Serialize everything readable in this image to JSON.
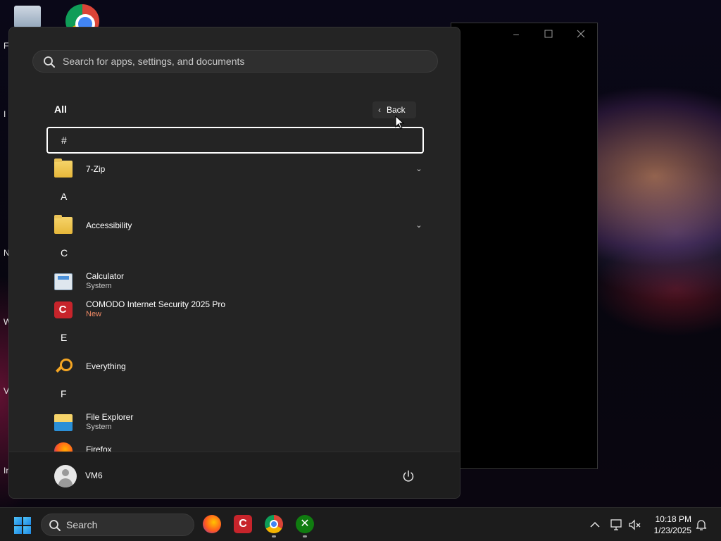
{
  "desktop": {
    "side_letters": [
      "F",
      "I",
      "N",
      "W",
      "V",
      "In"
    ]
  },
  "start_menu": {
    "search": {
      "placeholder": "Search for apps, settings, and documents"
    },
    "list_title": "All",
    "back_label": "Back",
    "groups": [
      {
        "letter": "#",
        "apps": [
          {
            "name": "7-Zip",
            "type": "folder"
          }
        ]
      },
      {
        "letter": "A",
        "apps": [
          {
            "name": "Accessibility",
            "type": "folder"
          }
        ]
      },
      {
        "letter": "C",
        "apps": [
          {
            "name": "Calculator",
            "subtitle": "System"
          },
          {
            "name": "COMODO Internet Security 2025 Pro",
            "subtitle": "New"
          }
        ]
      },
      {
        "letter": "E",
        "apps": [
          {
            "name": "Everything"
          }
        ]
      },
      {
        "letter": "F",
        "apps": [
          {
            "name": "File Explorer",
            "subtitle": "System"
          },
          {
            "name": "Firefox"
          }
        ]
      }
    ],
    "footer": {
      "user_name": "VM6"
    }
  },
  "taskbar": {
    "search_label": "Search",
    "pinned_apps": [
      "Firefox",
      "COMODO",
      "Google Chrome",
      "Xbox"
    ],
    "clock": {
      "time": "10:18 PM",
      "date": "1/23/2025"
    }
  },
  "icons": {
    "search": "search-icon",
    "back": "chevron-left-icon",
    "expand": "chevron-down-icon",
    "power": "power-icon",
    "start": "windows-logo-icon",
    "tray_overflow": "chevron-up-icon",
    "network": "network-icon",
    "volume": "volume-muted-icon",
    "notifications": "bell-icon"
  },
  "colors": {
    "menu_bg": "#242424",
    "accent_new": "#f28b66",
    "taskbar_bg": "#1c1c1c"
  }
}
